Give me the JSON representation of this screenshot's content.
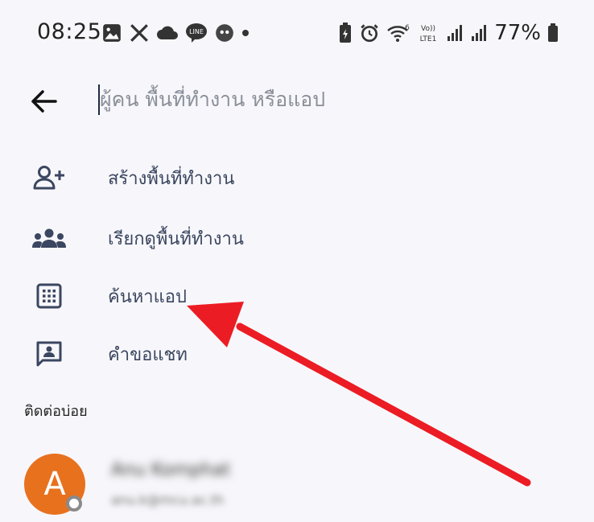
{
  "status": {
    "time": "08:25",
    "battery": "77%",
    "network": "LTE1"
  },
  "search": {
    "placeholder": "ผู้คน พื้นที่ทำงาน หรือแอป",
    "value": ""
  },
  "menu": [
    {
      "label": "สร้างพื้นที่ทำงาน",
      "icon": "add-person-icon"
    },
    {
      "label": "เรียกดูพื้นที่ทำงาน",
      "icon": "group-icon"
    },
    {
      "label": "ค้นหาแอป",
      "icon": "apps-grid-icon"
    },
    {
      "label": "คำขอแชท",
      "icon": "chat-request-icon"
    }
  ],
  "section": {
    "frequent_title": "ติดต่อบ่อย"
  },
  "contacts": [
    {
      "initial": "A",
      "name": "Anu Komphat",
      "email": "anu.k@mcu.ac.th",
      "avatar_color": "#e8711e"
    }
  ],
  "annotation": {
    "arrow_color": "#ec1c24",
    "points_to": "ค้นหาแอป"
  }
}
